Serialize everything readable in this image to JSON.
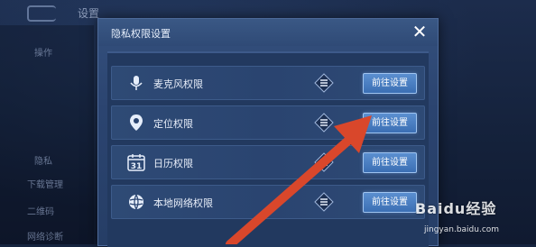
{
  "background": {
    "title": "设置",
    "sidebar": [
      "操作",
      "...",
      "...",
      "...",
      "隐私",
      "下载管理",
      "二维码",
      "网络诊断"
    ]
  },
  "dialog": {
    "title": "隐私权限设置",
    "close_icon": "close-icon",
    "rows": [
      {
        "label": "麦克风权限",
        "icon": "microphone-icon",
        "button": "前往设置"
      },
      {
        "label": "定位权限",
        "icon": "location-pin-icon",
        "button": "前往设置"
      },
      {
        "label": "日历权限",
        "icon": "calendar-icon",
        "button": "前往设置"
      },
      {
        "label": "本地网络权限",
        "icon": "globe-icon",
        "button": "前往设置"
      }
    ]
  },
  "calendar_day": "31",
  "watermark": {
    "brand": "Baidu经验",
    "url": "jingyan.baidu.com"
  },
  "colors": {
    "accent_button": "#4a7fc6",
    "annotation_arrow": "#d9472b"
  }
}
